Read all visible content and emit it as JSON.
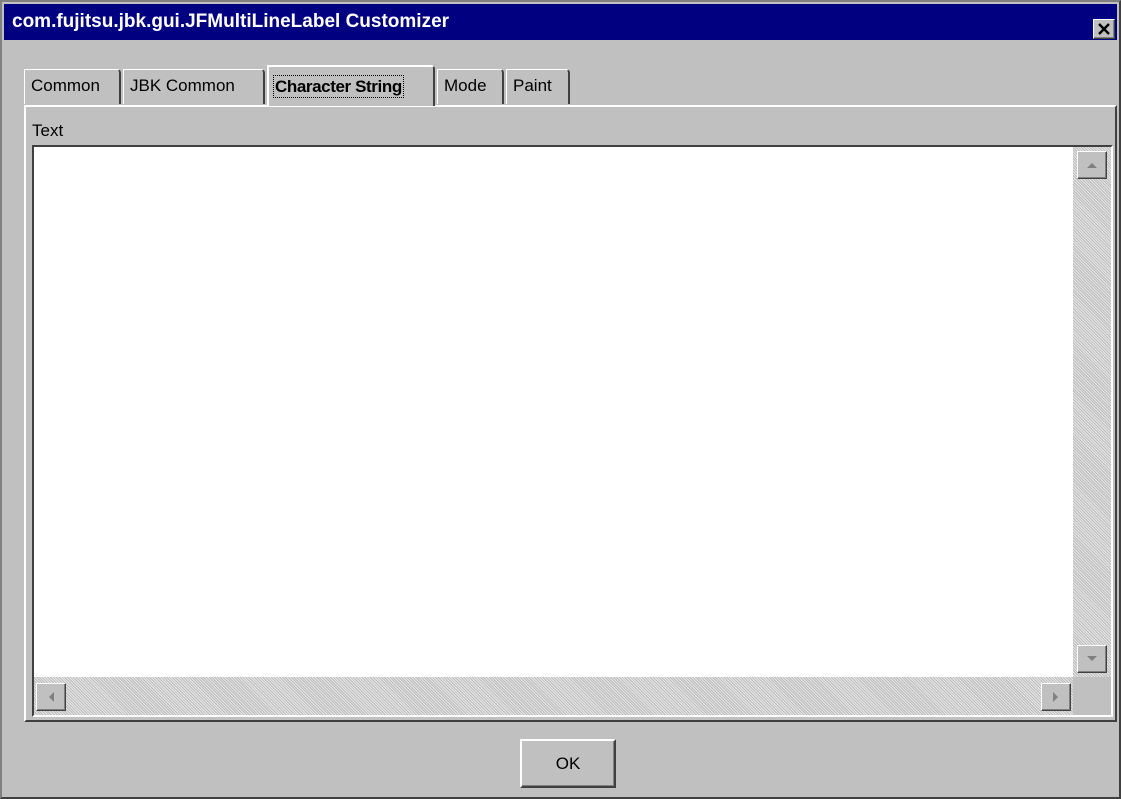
{
  "window": {
    "title": "com.fujitsu.jbk.gui.JFMultiLineLabel Customizer",
    "title_bar_color": "#000080",
    "face_color": "#c0c0c0",
    "close_icon": "close-icon"
  },
  "tabs": [
    {
      "label": "Common",
      "active": false
    },
    {
      "label": "JBK Common",
      "active": false
    },
    {
      "label": "Character String",
      "active": true
    },
    {
      "label": "Mode",
      "active": false
    },
    {
      "label": "Paint",
      "active": false
    }
  ],
  "panel": {
    "field_label": "Text",
    "text_value": ""
  },
  "scrollbars": {
    "up_icon": "arrow-up-icon",
    "down_icon": "arrow-down-icon",
    "left_icon": "arrow-left-icon",
    "right_icon": "arrow-right-icon"
  },
  "footer": {
    "ok_label": "OK"
  }
}
